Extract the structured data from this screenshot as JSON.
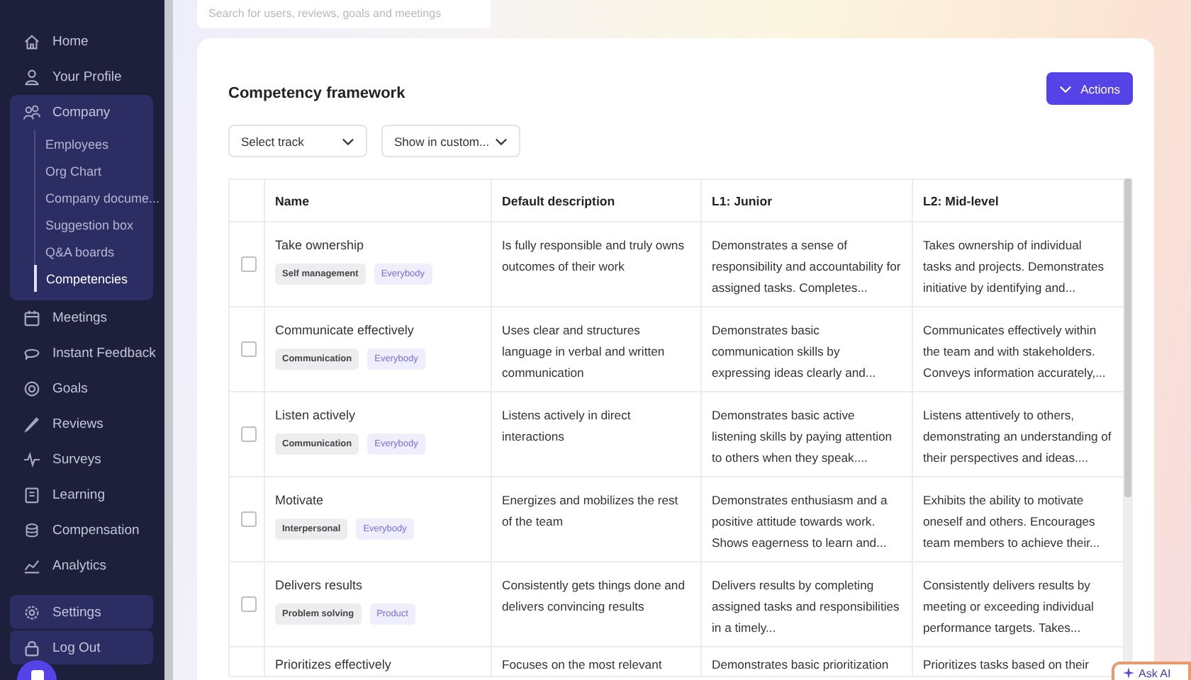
{
  "sidebar": {
    "items": [
      {
        "label": "Home",
        "kind": "link",
        "selected": false
      },
      {
        "label": "Your Profile",
        "kind": "link",
        "selected": false
      },
      {
        "label": "Company",
        "kind": "group",
        "selected": false,
        "expanded": true,
        "children": [
          {
            "label": "Employees",
            "selected": false
          },
          {
            "label": "Org Chart",
            "selected": false
          },
          {
            "label": "Company docume...",
            "selected": false
          },
          {
            "label": "Suggestion box",
            "selected": false
          },
          {
            "label": "Q&A boards",
            "selected": false
          },
          {
            "label": "Competencies",
            "selected": true
          }
        ]
      },
      {
        "label": "Meetings",
        "kind": "link",
        "selected": false
      },
      {
        "label": "Instant Feedback",
        "kind": "link",
        "selected": false
      },
      {
        "label": "Goals",
        "kind": "link",
        "selected": false
      },
      {
        "label": "Reviews",
        "kind": "link",
        "selected": false
      },
      {
        "label": "Surveys",
        "kind": "link",
        "selected": false
      },
      {
        "label": "Learning",
        "kind": "link",
        "selected": false
      },
      {
        "label": "Compensation",
        "kind": "link",
        "selected": false
      },
      {
        "label": "Analytics",
        "kind": "link",
        "selected": false
      }
    ],
    "bottom_items": [
      {
        "label": "Settings"
      },
      {
        "label": "Log Out"
      }
    ]
  },
  "search": {
    "placeholder": "Search for users, reviews, goals and meetings"
  },
  "card": {
    "title": "Competency framework",
    "actions_button": "Actions",
    "filters": [
      {
        "label": "Select track"
      },
      {
        "label": "Show in custom..."
      }
    ]
  },
  "table": {
    "columns": [
      "Name",
      "Default description",
      "L1: Junior",
      "L2: Mid-level"
    ],
    "rows": [
      {
        "checked": false,
        "name": "Take ownership",
        "tags": [
          {
            "label": "Self management",
            "kind": "category"
          },
          {
            "label": "Everybody",
            "kind": "audience"
          }
        ],
        "default_description": "Is fully responsible and truly owns outcomes of their work",
        "l1": "Demonstrates a sense of responsibility and accountability for assigned tasks. Completes...",
        "l2": "Takes ownership of individual tasks and projects. Demonstrates initiative by identifying and..."
      },
      {
        "checked": false,
        "name": "Communicate effectively",
        "tags": [
          {
            "label": "Communication",
            "kind": "category"
          },
          {
            "label": "Everybody",
            "kind": "audience"
          }
        ],
        "default_description": "Uses clear and structures language in verbal and written communication",
        "l1": "Demonstrates basic communication skills by expressing ideas clearly and...",
        "l2": "Communicates effectively within the team and with stakeholders. Conveys information accurately,..."
      },
      {
        "checked": false,
        "name": "Listen actively",
        "tags": [
          {
            "label": "Communication",
            "kind": "category"
          },
          {
            "label": "Everybody",
            "kind": "audience"
          }
        ],
        "default_description": "Listens actively in direct interactions",
        "l1": "Demonstrates basic active listening skills by paying attention to others when they speak....",
        "l2": "Listens attentively to others, demonstrating an understanding of their perspectives and ideas...."
      },
      {
        "checked": false,
        "name": "Motivate",
        "tags": [
          {
            "label": "Interpersonal",
            "kind": "category"
          },
          {
            "label": "Everybody",
            "kind": "audience"
          }
        ],
        "default_description": "Energizes and mobilizes the rest of the team",
        "l1": "Demonstrates enthusiasm and a positive attitude towards work. Shows eagerness to learn and...",
        "l2": "Exhibits the ability to motivate oneself and others. Encourages team members to achieve their..."
      },
      {
        "checked": false,
        "name": "Delivers results",
        "tags": [
          {
            "label": "Problem solving",
            "kind": "category"
          },
          {
            "label": "Product",
            "kind": "audience"
          }
        ],
        "default_description": "Consistently gets things done and delivers convincing results",
        "l1": "Delivers results by completing assigned tasks and responsibilities in a timely...",
        "l2": "Consistently delivers results by meeting or exceeding individual performance targets. Takes..."
      },
      {
        "name": "Prioritizes effectively",
        "tags": [],
        "default_description": "Focuses on the most relevant",
        "l1": "Demonstrates basic prioritization",
        "l2": "Prioritizes tasks based on their"
      }
    ]
  },
  "ask_ai_button": "Ask AI"
}
